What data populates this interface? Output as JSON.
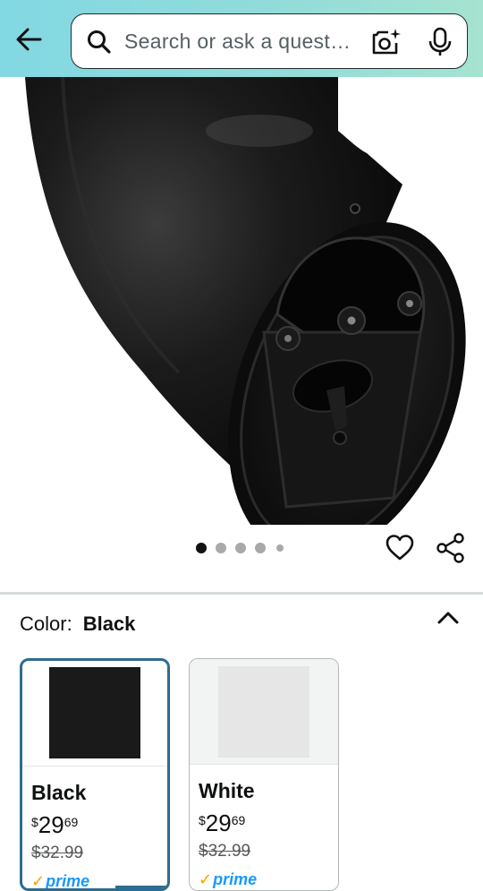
{
  "search": {
    "placeholder": "Search or ask a quest…"
  },
  "icons": {
    "back": "arrow-left-icon",
    "search": "magnifier-icon",
    "camera": "camera-sparkle-icon",
    "mic": "microphone-icon",
    "heart": "heart-outline-icon",
    "share": "share-icon",
    "collapse": "chevron-up-icon"
  },
  "gallery": {
    "image_count": 5,
    "active_index": 0
  },
  "color": {
    "label": "Color:",
    "selected": "Black"
  },
  "swatches": [
    {
      "name": "Black",
      "currency": "$",
      "price_whole": "29",
      "price_fraction": "69",
      "list_price": "$32.99",
      "badge": "prime",
      "chip_color": "#1a1a1a",
      "selected": true
    },
    {
      "name": "White",
      "currency": "$",
      "price_whole": "29",
      "price_fraction": "69",
      "list_price": "$32.99",
      "badge": "prime",
      "chip_color": "#e6e6e6",
      "selected": false
    }
  ],
  "colors": {
    "accent": "#2d6d8f",
    "prime_blue": "#1a98ff",
    "prime_check": "#f7a300"
  }
}
